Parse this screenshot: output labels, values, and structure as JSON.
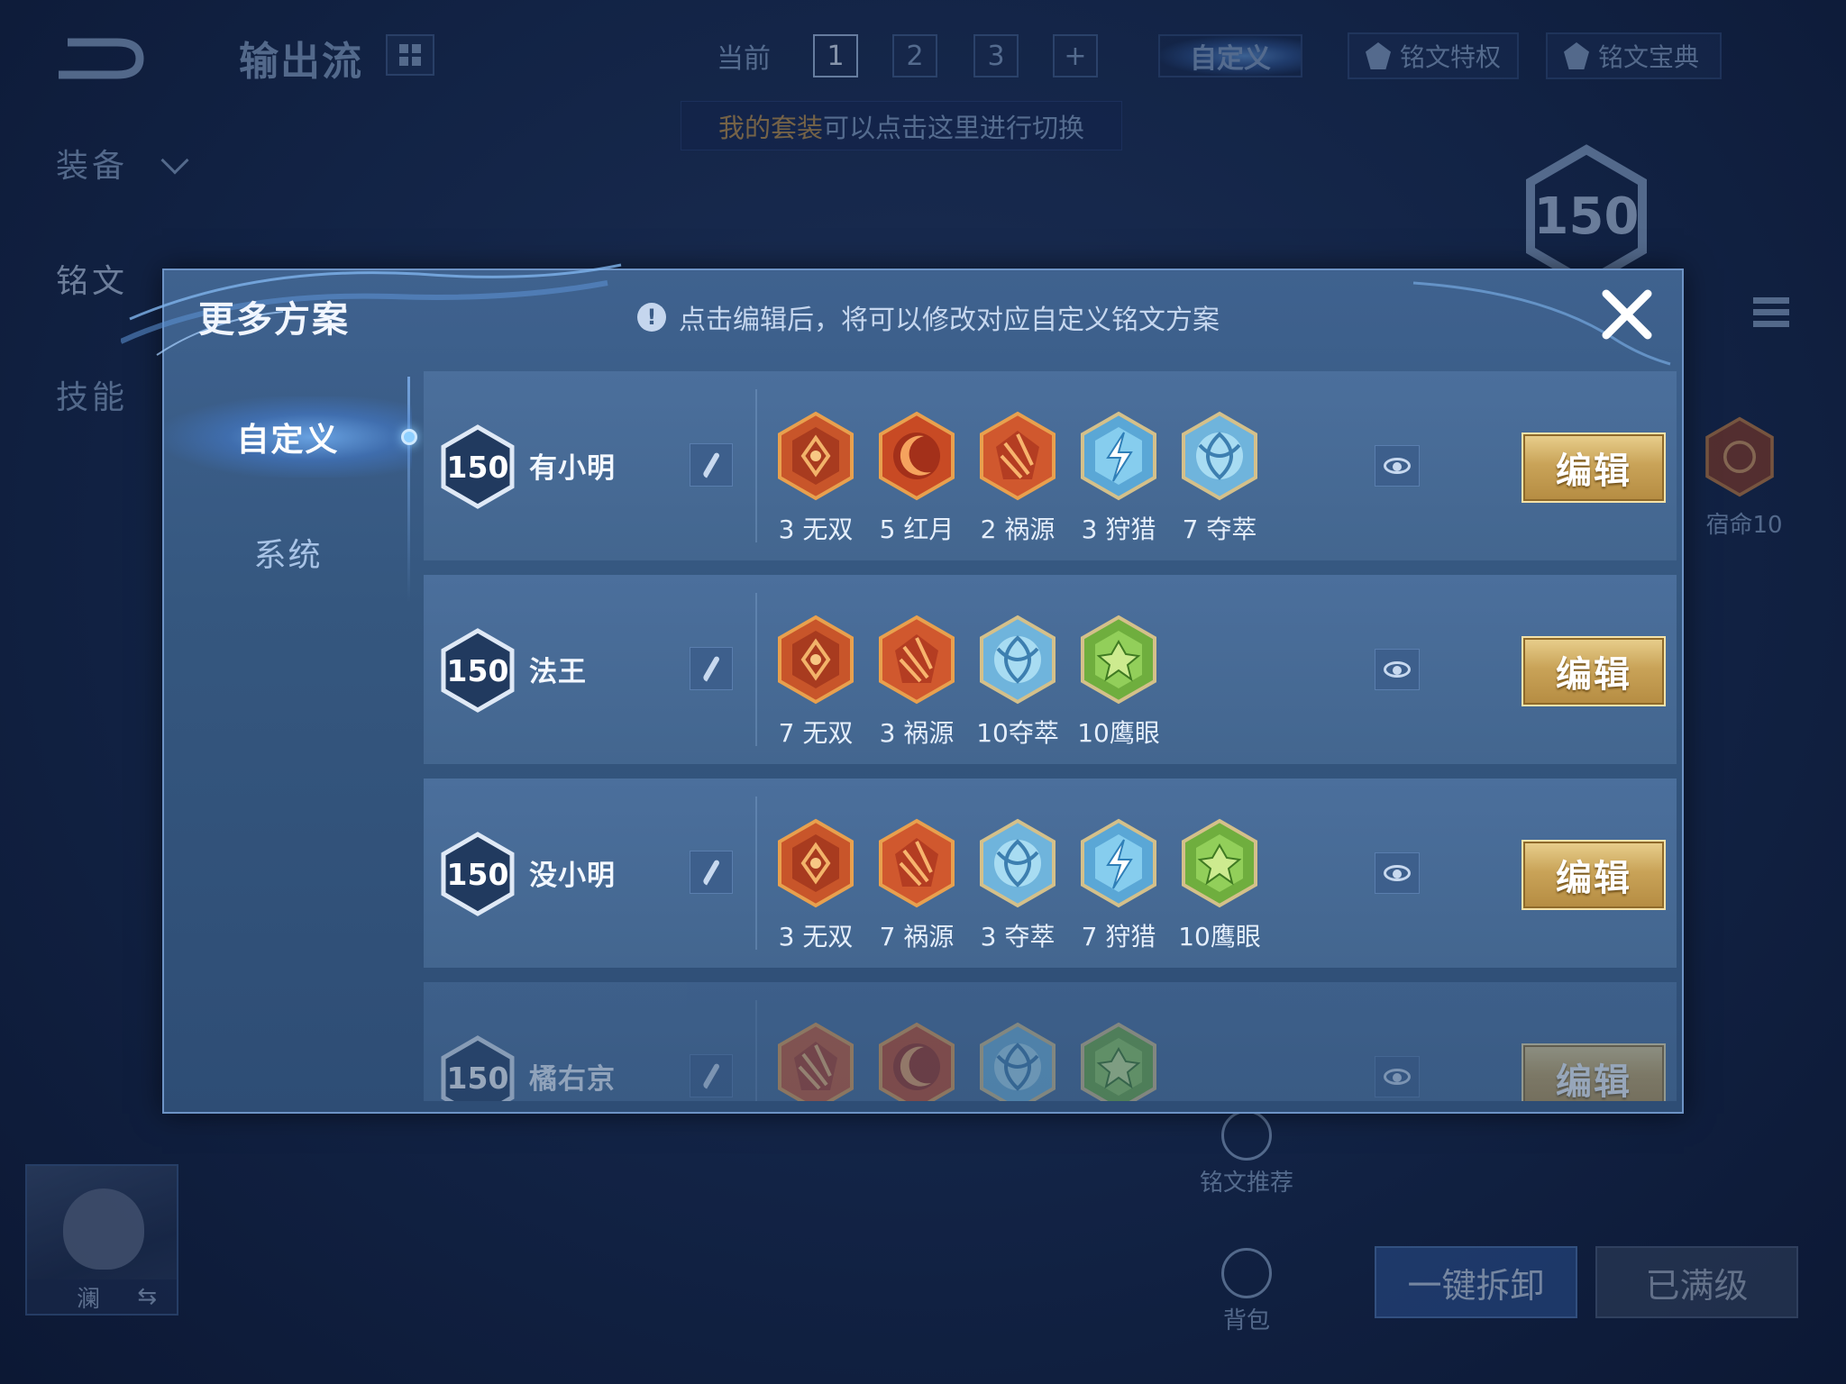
{
  "background": {
    "page_title": "输出流",
    "nav": {
      "equip": "装备",
      "rune": "铭文",
      "skill": "技能"
    },
    "tabs": {
      "current": "当前",
      "t1": "1",
      "t2": "2",
      "t3": "3",
      "plus": "+",
      "custom": "自定义"
    },
    "privilege_label": "铭文特权",
    "codex_label": "铭文宝典",
    "hint_highlight": "我的套装",
    "hint_rest": "可以点击这里进行切换",
    "level_total": "150",
    "fate_label": "宿命10",
    "hero_name": "澜",
    "swap_symbol": "⇆",
    "recommend_label": "铭文推荐",
    "bag_label": "背包",
    "unload_button": "一键拆卸",
    "maxed_button": "已满级"
  },
  "modal": {
    "title": "更多方案",
    "notice": "点击编辑后，将可以修改对应自定义铭文方案",
    "notice_icon": "!",
    "close_icon": "close-icon",
    "tabs": {
      "custom": "自定义",
      "system": "系统"
    },
    "edit_label": "编辑",
    "plans": [
      {
        "level": "150",
        "name": "有小明",
        "runes": [
          {
            "label": "3 无双",
            "type": "wushuang"
          },
          {
            "label": "5 红月",
            "type": "hongyue"
          },
          {
            "label": "2 祸源",
            "type": "huoyuan"
          },
          {
            "label": "3 狩猎",
            "type": "shoulie"
          },
          {
            "label": "7 夺萃",
            "type": "duocui"
          }
        ]
      },
      {
        "level": "150",
        "name": "法王",
        "runes": [
          {
            "label": "7 无双",
            "type": "wushuang"
          },
          {
            "label": "3 祸源",
            "type": "huoyuan"
          },
          {
            "label": "10夺萃",
            "type": "duocui"
          },
          {
            "label": "10鹰眼",
            "type": "yingyan"
          }
        ]
      },
      {
        "level": "150",
        "name": "没小明",
        "runes": [
          {
            "label": "3 无双",
            "type": "wushuang"
          },
          {
            "label": "7 祸源",
            "type": "huoyuan"
          },
          {
            "label": "3 夺萃",
            "type": "duocui"
          },
          {
            "label": "7 狩猎",
            "type": "shoulie"
          },
          {
            "label": "10鹰眼",
            "type": "yingyan"
          }
        ]
      },
      {
        "level": "150",
        "name": "橘右京",
        "runes": [
          {
            "label": "",
            "type": "huoyuan"
          },
          {
            "label": "",
            "type": "hongyue"
          },
          {
            "label": "",
            "type": "duocui"
          },
          {
            "label": "",
            "type": "yingyan"
          }
        ]
      }
    ]
  },
  "colors": {
    "gold_button": "#c9a358",
    "panel": "#35577f",
    "row": "#4b6f9c",
    "red_rune": "#d4552a",
    "blue_rune": "#7fc6ea",
    "green_rune": "#7cc24a"
  }
}
